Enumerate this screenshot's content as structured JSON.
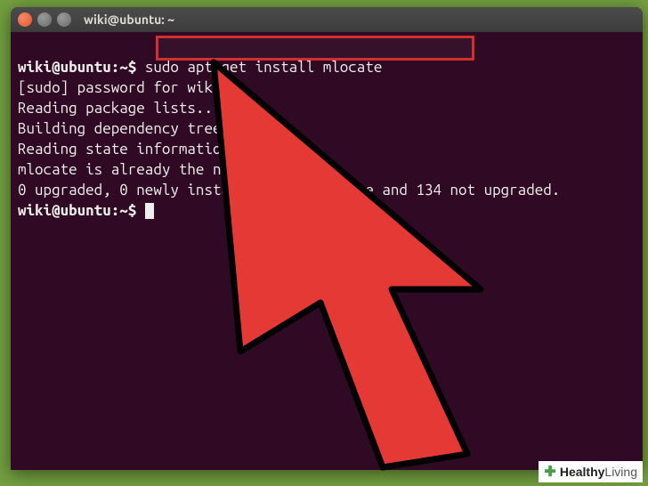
{
  "window": {
    "title": "wiki@ubuntu: ~"
  },
  "terminal": {
    "prompt": "wiki@ubuntu:~$",
    "command1": "sudo apt-get install mlocate",
    "line_sudopw": "[sudo] password for wiki:",
    "line_reading": "Reading package lists... Done",
    "line_building": "Building dependency tree",
    "line_state": "Reading state information... Done",
    "line_already": "mlocate is already the newest version.",
    "line_summary": "0 upgraded, 0 newly installed, 0 to remove and 134 not upgraded.",
    "prompt2": "wiki@ubuntu:~$"
  },
  "watermark": {
    "brand_strong": "Healthy",
    "brand_light": "Living"
  },
  "colors": {
    "bg_desktop": "#74a040",
    "bg_terminal": "#300a24",
    "highlight_border": "#d32f2f",
    "arrow_fill": "#e53935"
  }
}
